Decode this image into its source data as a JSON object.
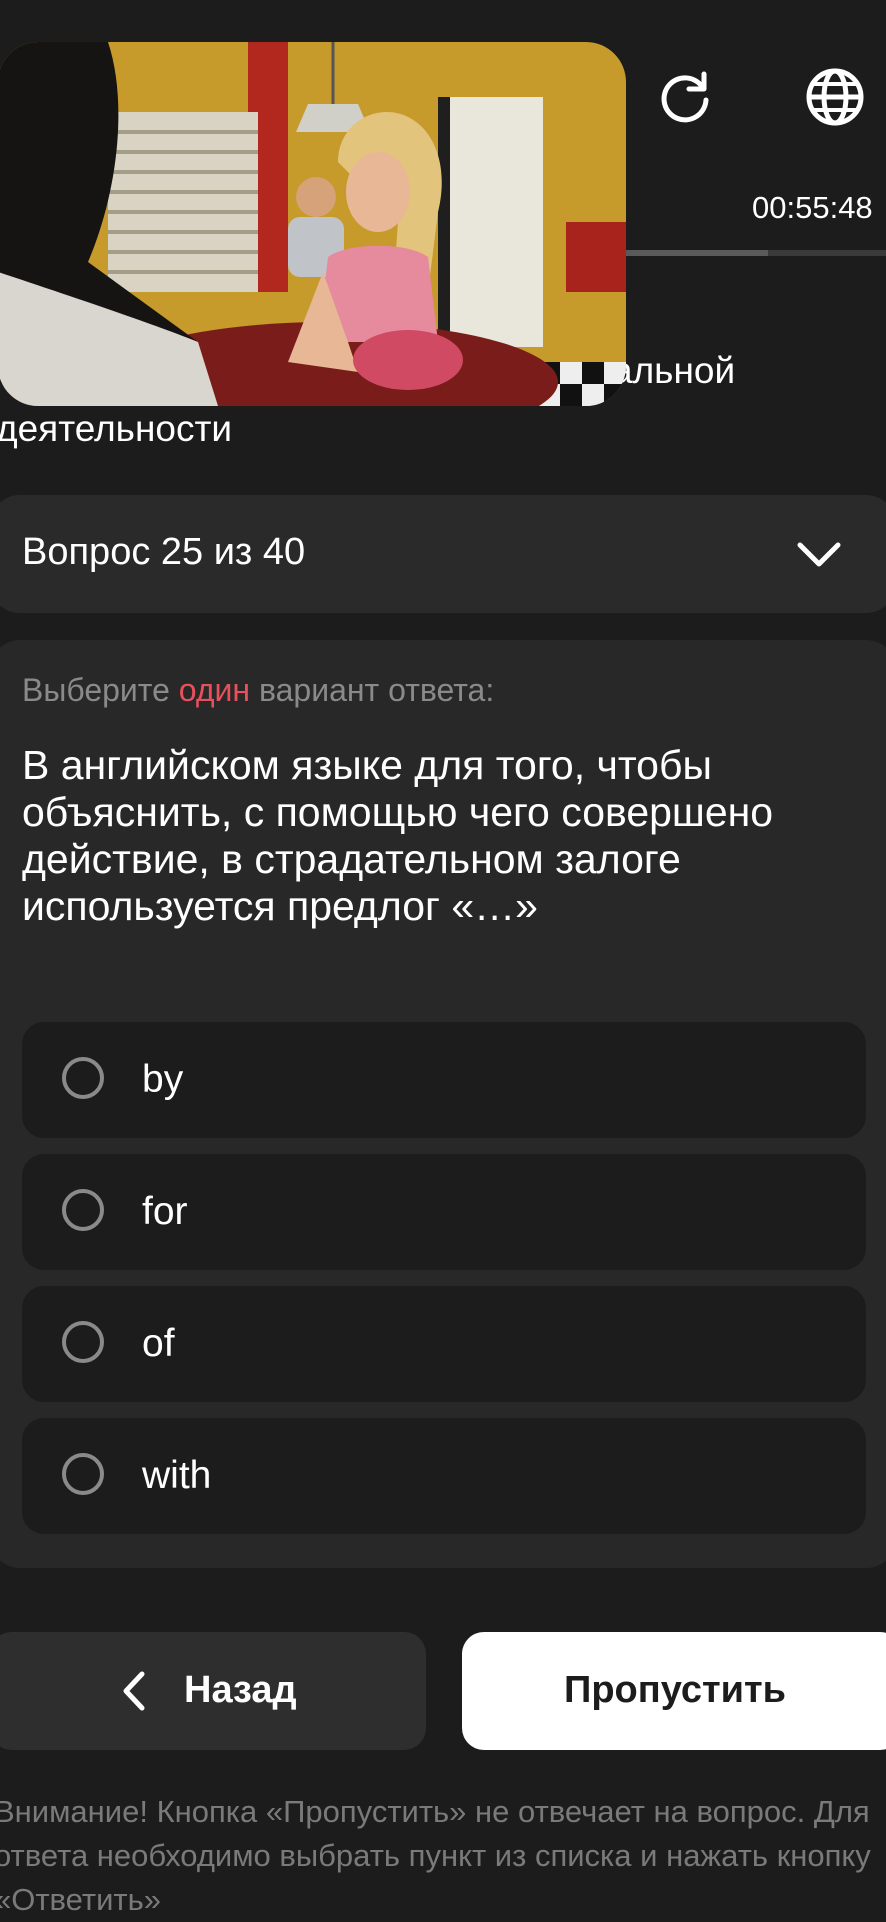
{
  "header": {
    "timer": "00:55:48",
    "progress_fraction": 0.55,
    "title_line1": "альной",
    "title_line2": "деятельности"
  },
  "question_selector": {
    "label": "Вопрос 25 из 40"
  },
  "question": {
    "hint_prefix": "Выберите",
    "hint_accent": "один",
    "hint_suffix": "вариант ответа:",
    "text": "В английском языке для того, чтобы объяснить, с помощью чего совершено действие, в страдательном залоге используется предлог «…»",
    "options": [
      {
        "label": "by"
      },
      {
        "label": "for"
      },
      {
        "label": "of"
      },
      {
        "label": "with"
      }
    ]
  },
  "buttons": {
    "back": "Назад",
    "skip": "Пропустить"
  },
  "notice": "Внимание! Кнопка «Пропустить» не отвечает на вопрос. Для ответа необходимо выбрать пункт из списка и нажать кнопку «Ответить»",
  "colors": {
    "background": "#1c1c1c",
    "card": "#282828",
    "accent": "#e8505b"
  }
}
